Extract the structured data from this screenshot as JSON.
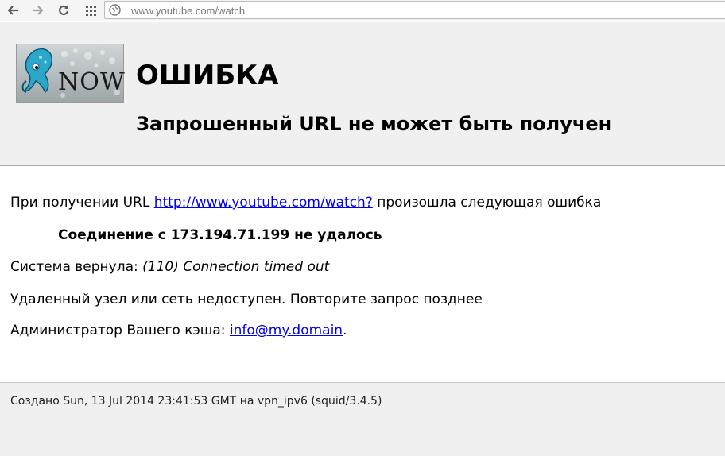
{
  "browser": {
    "url": "www.youtube.com/watch",
    "icons": {
      "back": "back-arrow-icon",
      "forward": "forward-arrow-icon",
      "reload": "reload-icon",
      "apps": "apps-grid-icon",
      "site": "site-info-icon"
    }
  },
  "page": {
    "logo_text": "NOW",
    "title": "ОШИБКА",
    "subtitle": "Запрошенный URL не может быть получен",
    "fetch_prefix": "При получении URL ",
    "fetch_link": "http://www.youtube.com/watch?",
    "fetch_suffix": " произошла следующая ошибка",
    "connection_error": "Соединение с 173.194.71.199 не удалось",
    "system_prefix": "Система вернула: ",
    "system_value": "(110) Connection timed out",
    "unreachable": "Удаленный узел или сеть недоступен. Повторите запрос позднее",
    "admin_prefix": "Администратор Вашего кэша: ",
    "admin_email": "info@my.domain",
    "admin_suffix": ".",
    "footer": "Создано Sun, 13 Jul 2014 23:41:53 GMT на vpn_ipv6 (squid/3.4.5)"
  },
  "colors": {
    "header_bg": "#f0f0f0",
    "link": "#0000ee",
    "toolbar_bg": "#f5f5f5"
  }
}
